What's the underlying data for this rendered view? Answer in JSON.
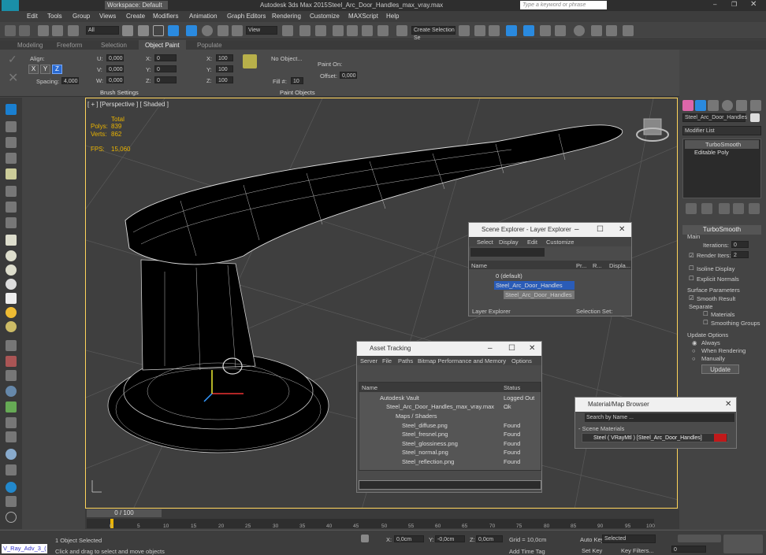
{
  "app": {
    "title": "Autodesk 3ds Max  2015",
    "file": "Steel_Arc_Door_Handles_max_vray.max",
    "workspace": "Workspace: Default",
    "search_placeholder": "Type a keyword or phrase"
  },
  "menu": [
    "Edit",
    "Tools",
    "Group",
    "Views",
    "Create",
    "Modifiers",
    "Animation",
    "Graph Editors",
    "Rendering",
    "Customize",
    "MAXScript",
    "Help"
  ],
  "toolbar": {
    "filter": "All",
    "view": "View",
    "sel_set": "Create Selection Se"
  },
  "ribbon_tabs": [
    "Modeling",
    "Freeform",
    "Selection",
    "Object Paint",
    "Populate"
  ],
  "ribbon": {
    "align": "Align:",
    "spacing": "Spacing:",
    "spacing_val": "4,000",
    "u": "U:",
    "v": "V:",
    "w": "W:",
    "x": "X:",
    "y": "Y:",
    "z": "Z:",
    "val0": "0,000",
    "val1": "0",
    "val100": "100",
    "no_object": "No Object...",
    "paint_on": "Paint On:",
    "offset": "Offset:",
    "offset_val": "0,000",
    "fill": "Fill #:",
    "fill_val": "10",
    "brush_settings": "Brush Settings",
    "paint_objects": "Paint Objects",
    "xyz": [
      "X",
      "Y",
      "Z"
    ]
  },
  "viewport": {
    "label": "[ + ] [Perspective ] [ Shaded ]",
    "stats": {
      "total": "Total",
      "polys_l": "Polys:",
      "polys": "839",
      "verts_l": "Verts:",
      "verts": "862",
      "fps_l": "FPS:",
      "fps": "15,060"
    }
  },
  "cmd": {
    "object_name": "Steel_Arc_Door_Handles",
    "modifier_list": "Modifier List",
    "stack": [
      "TurboSmooth",
      "Editable Poly"
    ],
    "rollout": "TurboSmooth",
    "main": "Main",
    "iterations_l": "Iterations:",
    "iterations": "0",
    "render_iters_l": "Render Iters:",
    "render_iters": "2",
    "isoline": "Isoline Display",
    "explicit": "Explicit Normals",
    "surface": "Surface Parameters",
    "smooth": "Smooth Result",
    "separate": "Separate",
    "materials": "Materials",
    "groups": "Smoothing Groups",
    "update_opts": "Update Options",
    "always": "Always",
    "when_render": "When Rendering",
    "manually": "Manually",
    "update": "Update"
  },
  "scene_explorer": {
    "title": "Scene Explorer - Layer Explorer",
    "menu": [
      "Select",
      "Display",
      "Edit",
      "Customize"
    ],
    "cols": [
      "Name",
      "Pr...",
      "R...",
      "Displa..."
    ],
    "rows": [
      "0 (default)",
      "Steel_Arc_Door_Handles",
      "Steel_Arc_Door_Handles"
    ],
    "footer": "Layer Explorer",
    "selset": "Selection Set:"
  },
  "asset": {
    "title": "Asset Tracking",
    "menu": [
      "Server",
      "File",
      "Paths",
      "Bitmap Performance and Memory",
      "Options"
    ],
    "cols": [
      "Name",
      "Status"
    ],
    "rows": [
      {
        "n": "Autodesk Vault",
        "s": "Logged Out ..."
      },
      {
        "n": "Steel_Arc_Door_Handles_max_vray.max",
        "s": "Ok"
      },
      {
        "n": "Maps / Shaders",
        "s": ""
      },
      {
        "n": "Steel_diffuse.png",
        "s": "Found"
      },
      {
        "n": "Steel_fresnel.png",
        "s": "Found"
      },
      {
        "n": "Steel_glossiness.png",
        "s": "Found"
      },
      {
        "n": "Steel_normal.png",
        "s": "Found"
      },
      {
        "n": "Steel_reflection.png",
        "s": "Found"
      }
    ]
  },
  "matbrowser": {
    "title": "Material/Map Browser",
    "search": "Search by Name ...",
    "section": "- Scene Materials",
    "item": "Steel  ( VRayMtl ) [Steel_Arc_Door_Handles]"
  },
  "timeline": {
    "frame": "0 / 100",
    "ticks": [
      "0",
      "5",
      "10",
      "15",
      "20",
      "25",
      "30",
      "35",
      "40",
      "45",
      "50",
      "55",
      "60",
      "65",
      "70",
      "75",
      "80",
      "85",
      "90",
      "95",
      "100"
    ]
  },
  "status": {
    "script": "V_Ray_Adv_3_(",
    "selected": "1 Object Selected",
    "hint": "Click and drag to select and move objects",
    "x": "0,0cm",
    "y": "-0,0cm",
    "z": "0,0cm",
    "grid": "Grid = 10,0cm",
    "add_time_tag": "Add Time Tag",
    "auto_key": "Auto Key",
    "selected_dd": "Selected",
    "set_key": "Set Key",
    "key_filters": "Key Filters...",
    "frame": "0"
  }
}
